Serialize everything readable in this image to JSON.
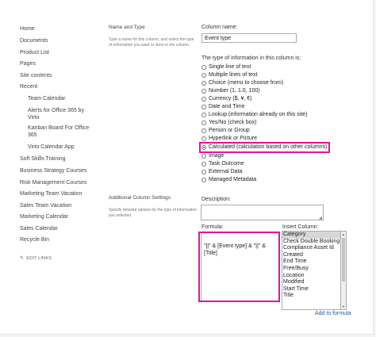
{
  "nav": {
    "items": [
      "Home",
      "Documents",
      "Product List",
      "Pages",
      "Site contents",
      "Recent"
    ],
    "recent": [
      "Team Calendar",
      "Alerts for Office 365 by Virto",
      "Kanban Board For Office 365",
      "Virto Calendar App"
    ],
    "more": [
      "Soft Skills Training",
      "Business Strategy Courses",
      "Risk Management Courses",
      "Marketing Team Vacation",
      "Sales Team Vacation",
      "Marketing Calendar",
      "Sales Calendar",
      "Recycle Bin"
    ],
    "edit_links": "EDIT LINKS"
  },
  "name_type": {
    "title": "Name and Type",
    "description": "Type a name for this column, and select the type of information you want to store in the column."
  },
  "additional": {
    "title": "Additional Column Settings",
    "description": "Specify detailed options for the type of information you selected."
  },
  "column_name": {
    "label": "Column name:",
    "value": "Event type"
  },
  "type_label": "The type of information in this column is:",
  "types": [
    "Single line of text",
    "Multiple lines of text",
    "Choice (menu to choose from)",
    "Number (1, 1.0, 100)",
    "Currency ($, ¥, €)",
    "Date and Time",
    "Lookup (information already on this site)",
    "Yes/No (check box)",
    "Person or Group",
    "Hyperlink or Picture",
    "Calculated (calculation based on other columns)",
    "Image",
    "Task Outcome",
    "External Data",
    "Managed Metadata"
  ],
  "selected_type": "Calculated (calculation based on other columns)",
  "description_label": "Description:",
  "formula": {
    "label": "Formula:",
    "value": "\"||\" & [Event type] & \"||\" & [Title]"
  },
  "insert_column": {
    "label": "Insert Column:",
    "items": [
      "Category",
      "Check Double Booking",
      "Compliance Asset Id",
      "Created",
      "End Time",
      "Free/Busy",
      "Location",
      "Modified",
      "Start Time",
      "Title"
    ],
    "selected": "Category"
  },
  "add_to_formula": "Add to formula",
  "colors": {
    "highlight": "#e0149a",
    "link": "#1d5da8",
    "selected_item_bg": "#d7d7d7"
  }
}
